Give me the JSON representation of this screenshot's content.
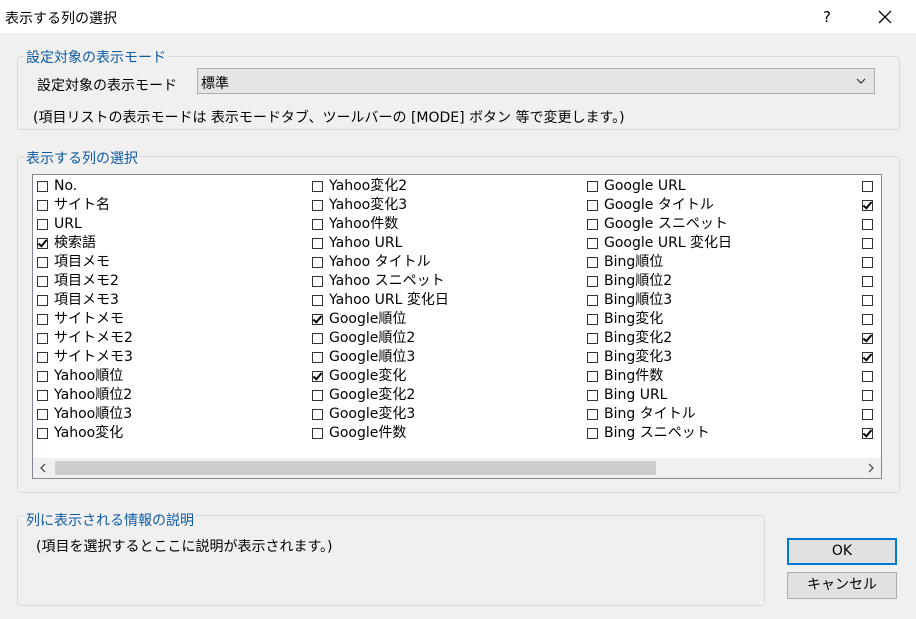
{
  "window": {
    "title": "表示する列の選択",
    "help_label": "?"
  },
  "display_mode_group": {
    "legend": "設定対象の表示モード",
    "label": "設定対象の表示モード",
    "selected": "標準",
    "note": "(項目リストの表示モードは 表示モードタブ、ツールバーの [MODE] ボタン 等で変更します。)"
  },
  "columns_group": {
    "legend": "表示する列の選択",
    "columns": [
      [
        {
          "label": "No.",
          "checked": false
        },
        {
          "label": "サイト名",
          "checked": false
        },
        {
          "label": "URL",
          "checked": false
        },
        {
          "label": "検索語",
          "checked": true
        },
        {
          "label": "項目メモ",
          "checked": false
        },
        {
          "label": "項目メモ2",
          "checked": false
        },
        {
          "label": "項目メモ3",
          "checked": false
        },
        {
          "label": "サイトメモ",
          "checked": false
        },
        {
          "label": "サイトメモ2",
          "checked": false
        },
        {
          "label": "サイトメモ3",
          "checked": false
        },
        {
          "label": "Yahoo順位",
          "checked": false
        },
        {
          "label": "Yahoo順位2",
          "checked": false
        },
        {
          "label": "Yahoo順位3",
          "checked": false
        },
        {
          "label": "Yahoo変化",
          "checked": false
        }
      ],
      [
        {
          "label": "Yahoo変化2",
          "checked": false
        },
        {
          "label": "Yahoo変化3",
          "checked": false
        },
        {
          "label": "Yahoo件数",
          "checked": false
        },
        {
          "label": "Yahoo URL",
          "checked": false
        },
        {
          "label": "Yahoo タイトル",
          "checked": false
        },
        {
          "label": "Yahoo スニペット",
          "checked": false
        },
        {
          "label": "Yahoo URL 変化日",
          "checked": false
        },
        {
          "label": "Google順位",
          "checked": true
        },
        {
          "label": "Google順位2",
          "checked": false
        },
        {
          "label": "Google順位3",
          "checked": false
        },
        {
          "label": "Google変化",
          "checked": true
        },
        {
          "label": "Google変化2",
          "checked": false
        },
        {
          "label": "Google変化3",
          "checked": false
        },
        {
          "label": "Google件数",
          "checked": false
        }
      ],
      [
        {
          "label": "Google URL",
          "checked": false
        },
        {
          "label": "Google タイトル",
          "checked": false
        },
        {
          "label": "Google スニペット",
          "checked": false
        },
        {
          "label": "Google URL 変化日",
          "checked": false
        },
        {
          "label": "Bing順位",
          "checked": false
        },
        {
          "label": "Bing順位2",
          "checked": false
        },
        {
          "label": "Bing順位3",
          "checked": false
        },
        {
          "label": "Bing変化",
          "checked": false
        },
        {
          "label": "Bing変化2",
          "checked": false
        },
        {
          "label": "Bing変化3",
          "checked": false
        },
        {
          "label": "Bing件数",
          "checked": false
        },
        {
          "label": "Bing URL",
          "checked": false
        },
        {
          "label": "Bing タイトル",
          "checked": false
        },
        {
          "label": "Bing スニペット",
          "checked": false
        }
      ],
      [
        {
          "label": "",
          "checked": false
        },
        {
          "label": "",
          "checked": true
        },
        {
          "label": "",
          "checked": false
        },
        {
          "label": "",
          "checked": false
        },
        {
          "label": "",
          "checked": false
        },
        {
          "label": "",
          "checked": false
        },
        {
          "label": "",
          "checked": false
        },
        {
          "label": "",
          "checked": false
        },
        {
          "label": "",
          "checked": true
        },
        {
          "label": "",
          "checked": true
        },
        {
          "label": "",
          "checked": false
        },
        {
          "label": "",
          "checked": false
        },
        {
          "label": "",
          "checked": false
        },
        {
          "label": "",
          "checked": true
        }
      ]
    ]
  },
  "description_group": {
    "legend": "列に表示される情報の説明",
    "text": "(項目を選択するとここに説明が表示されます。)"
  },
  "buttons": {
    "ok": "OK",
    "cancel": "キャンセル"
  },
  "colors": {
    "group_legend": "#0f5aa6",
    "default_button_border": "#0078d7"
  }
}
